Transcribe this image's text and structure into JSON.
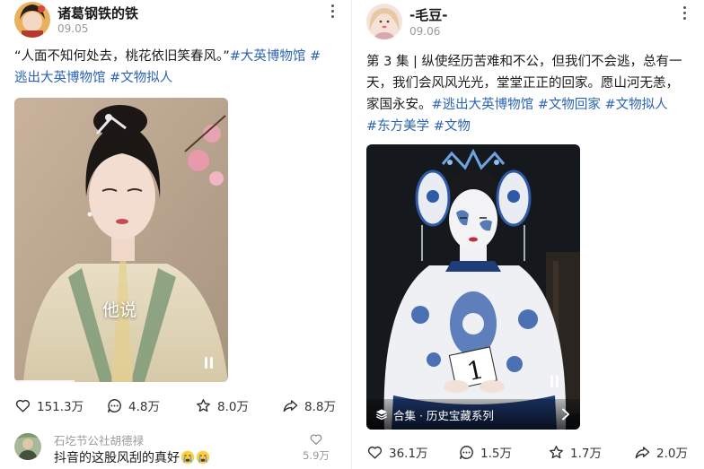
{
  "posts": [
    {
      "username": "诸葛钢铁的铁",
      "date": "09.05",
      "content": {
        "lines": [
          [
            {
              "text": "“人面不知何处去，桃花依旧笑春风。”",
              "tag": false
            },
            {
              "text": "#大英博物馆",
              "tag": true
            },
            {
              "text": " #",
              "tag": true
            }
          ],
          [
            {
              "text": "逃出大英博物馆",
              "tag": true
            },
            {
              "text": " ",
              "tag": false
            },
            {
              "text": "#文物拟人",
              "tag": true
            }
          ]
        ]
      },
      "media": {
        "overlay_text": "他说",
        "progress": 0.28
      },
      "actions": {
        "likes": "151.3万",
        "comments": "4.8万",
        "favorites": "8.0万",
        "shares": "8.8万"
      },
      "top_comment": {
        "author": "石圪节公社胡德禄",
        "text": "抖音的这股风刮的真好",
        "emoji": [
          "crying-emoji",
          "crying-emoji"
        ],
        "likes": "5.9万"
      }
    },
    {
      "username": "-毛豆-",
      "date": "09.06",
      "content": {
        "lines": [
          [
            {
              "text": "第 3 集 | 纵使经历苦难和不公，但我们不会逃，总有一",
              "tag": false
            }
          ],
          [
            {
              "text": "天，我们会风风光光，堂堂正正的回家。愿山河无恙，",
              "tag": false
            }
          ],
          [
            {
              "text": "家国永安。",
              "tag": false
            },
            {
              "text": "#逃出大英博物馆",
              "tag": true
            },
            {
              "text": " ",
              "tag": false
            },
            {
              "text": "#文物回家",
              "tag": true
            },
            {
              "text": " ",
              "tag": false
            },
            {
              "text": "#文物拟人",
              "tag": true
            }
          ],
          [
            {
              "text": "#东方美学",
              "tag": true
            },
            {
              "text": " ",
              "tag": false
            },
            {
              "text": "#文物",
              "tag": true
            }
          ]
        ]
      },
      "media": {
        "collection_label": "合集 · 历史宝藏系列"
      },
      "actions": {
        "likes": "36.1万",
        "comments": "1.5万",
        "favorites": "1.7万",
        "shares": "2.0万"
      }
    }
  ]
}
